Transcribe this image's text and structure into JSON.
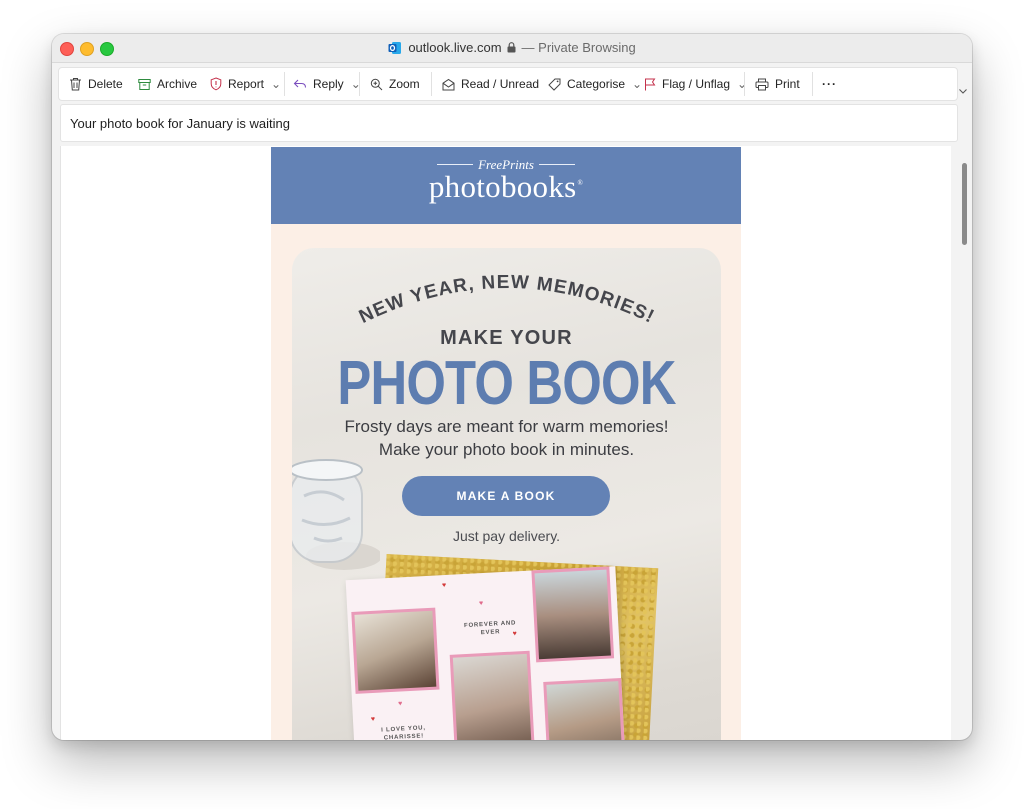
{
  "window": {
    "url": "outlook.live.com",
    "mode": "— Private Browsing",
    "outlook_icon": "outlook-icon",
    "lock_icon": "lock-icon"
  },
  "toolbar": {
    "delete": "Delete",
    "archive": "Archive",
    "report": "Report",
    "reply": "Reply",
    "zoom": "Zoom",
    "read_unread": "Read / Unread",
    "categorise": "Categorise",
    "flag": "Flag / Unflag",
    "print": "Print",
    "more": "···"
  },
  "message": {
    "subject": "Your photo book for January is waiting"
  },
  "email": {
    "brand_top": "FreePrints",
    "brand_main": "photobooks",
    "brand_mark": "®",
    "curved_title": "NEW YEAR, NEW MEMORIES!",
    "make_your": "MAKE YOUR",
    "headline": "PHOTO BOOK",
    "line1": "Frosty days are meant for warm memories!",
    "line2": "Make your photo book in minutes.",
    "cta": "MAKE A BOOK",
    "pay_note": "Just pay delivery.",
    "book_text1": "FOREVER AND EVER",
    "book_text2": "I LOVE YOU, CHARISSE!"
  },
  "colors": {
    "brand_blue": "#6382b5",
    "email_bg": "#fcefe6",
    "photo_border": "#e99bb9"
  }
}
